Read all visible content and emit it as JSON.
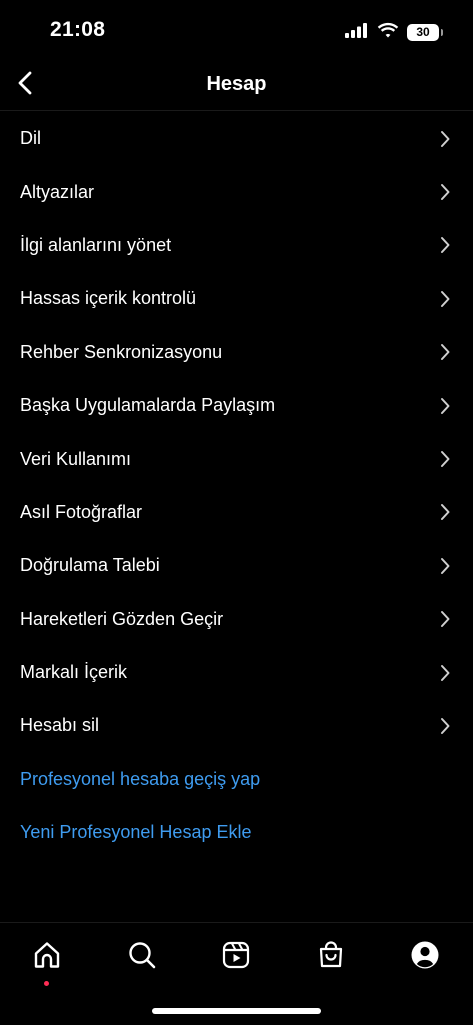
{
  "status_bar": {
    "time": "21:08",
    "battery": "30",
    "icons": [
      "signal-icon",
      "wifi-icon",
      "battery-icon"
    ]
  },
  "header": {
    "title": "Hesap",
    "back_icon": "chevron-left-icon"
  },
  "menu": {
    "items": [
      {
        "label": "Dil"
      },
      {
        "label": "Altyazılar"
      },
      {
        "label": "İlgi alanlarını yönet"
      },
      {
        "label": "Hassas içerik kontrolü"
      },
      {
        "label": "Rehber Senkronizasyonu"
      },
      {
        "label": "Başka Uygulamalarda Paylaşım"
      },
      {
        "label": "Veri Kullanımı"
      },
      {
        "label": "Asıl Fotoğraflar"
      },
      {
        "label": "Doğrulama Talebi"
      },
      {
        "label": "Hareketleri Gözden Geçir"
      },
      {
        "label": "Markalı İçerik"
      },
      {
        "label": "Hesabı sil"
      }
    ],
    "links": [
      {
        "label": "Profesyonel hesaba geçiş yap"
      },
      {
        "label": "Yeni Profesyonel Hesap Ekle"
      }
    ]
  },
  "bottom_nav": {
    "icons": [
      "home-icon",
      "search-icon",
      "reels-icon",
      "shop-icon",
      "profile-icon"
    ]
  },
  "colors": {
    "background": "#000000",
    "text": "#ffffff",
    "link": "#3f9cf0",
    "chevron": "#d0d0d0",
    "notification_dot": "#ff2d55"
  }
}
